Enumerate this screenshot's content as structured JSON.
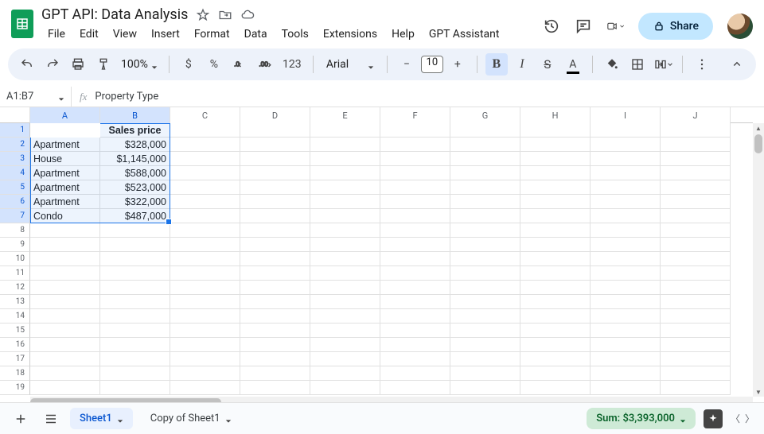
{
  "doc": {
    "title": "GPT API: Data Analysis"
  },
  "menus": {
    "file": "File",
    "edit": "Edit",
    "view": "View",
    "insert": "Insert",
    "format": "Format",
    "data": "Data",
    "tools": "Tools",
    "extensions": "Extensions",
    "help": "Help",
    "gpt": "GPT Assistant"
  },
  "toolbar": {
    "zoom": "100%",
    "currency": "$",
    "percent": "%",
    "auto_fmt": "123",
    "font_name": "Arial",
    "font_size": "10",
    "bold": "B",
    "italic": "I",
    "strike": "S",
    "textcolor": "A"
  },
  "share": {
    "label": "Share"
  },
  "namebox": {
    "ref": "A1:B7"
  },
  "formula": {
    "fx": "fx",
    "content": "Property Type"
  },
  "columns": [
    "A",
    "B",
    "C",
    "D",
    "E",
    "F",
    "G",
    "H",
    "I",
    "J"
  ],
  "row_labels": [
    "1",
    "2",
    "3",
    "4",
    "5",
    "6",
    "7",
    "8",
    "9",
    "10",
    "11",
    "12",
    "13",
    "14",
    "15",
    "16",
    "17",
    "18",
    "19"
  ],
  "headers": {
    "a": "Property Type",
    "b": "Sales price"
  },
  "rows": [
    {
      "a": "Apartment",
      "b": "$328,000"
    },
    {
      "a": "House",
      "b": "$1,145,000"
    },
    {
      "a": "Apartment",
      "b": "$588,000"
    },
    {
      "a": "Apartment",
      "b": "$523,000"
    },
    {
      "a": "Apartment",
      "b": "$322,000"
    },
    {
      "a": "Condo",
      "b": "$487,000"
    }
  ],
  "tabs": {
    "sheet1": "Sheet1",
    "copy": "Copy of Sheet1"
  },
  "status": {
    "sum": "Sum: $3,393,000"
  }
}
